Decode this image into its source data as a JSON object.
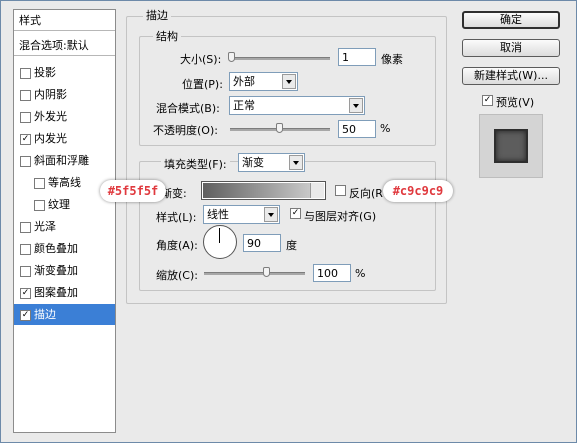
{
  "sidebar": {
    "header": "样式",
    "blend_options": "混合选项:默认",
    "items": [
      {
        "label": "投影",
        "checked": false
      },
      {
        "label": "内阴影",
        "checked": false
      },
      {
        "label": "外发光",
        "checked": false
      },
      {
        "label": "内发光",
        "checked": true
      },
      {
        "label": "斜面和浮雕",
        "checked": false
      },
      {
        "label": "等高线",
        "checked": false
      },
      {
        "label": "纹理",
        "checked": false
      },
      {
        "label": "光泽",
        "checked": false
      },
      {
        "label": "颜色叠加",
        "checked": false
      },
      {
        "label": "渐变叠加",
        "checked": false
      },
      {
        "label": "图案叠加",
        "checked": true
      },
      {
        "label": "描边",
        "checked": true
      }
    ]
  },
  "stroke": {
    "title": "描边",
    "structure": {
      "title": "结构",
      "size_label": "大小(S):",
      "size_value": "1",
      "size_unit": "像素",
      "position_label": "位置(P):",
      "position_value": "外部",
      "blend_label": "混合模式(B):",
      "blend_value": "正常",
      "opacity_label": "不透明度(O):",
      "opacity_value": "50",
      "opacity_unit": "%"
    },
    "fill": {
      "type_label": "填充类型(F):",
      "type_value": "渐变",
      "gradient_label": "渐变:",
      "reverse_label": "反向(R",
      "style_label": "样式(L):",
      "style_value": "线性",
      "align_label": "与图层对齐(G)",
      "angle_label": "角度(A):",
      "angle_value": "90",
      "angle_unit": "度",
      "scale_label": "缩放(C):",
      "scale_value": "100",
      "scale_unit": "%"
    }
  },
  "buttons": {
    "ok": "确定",
    "cancel": "取消",
    "new_style": "新建样式(W)...",
    "preview_label": "预览(V)"
  },
  "annotations": {
    "left_color": "#5f5f5f",
    "right_color": "#c9c9c9"
  },
  "colors": {
    "selection": "#3b7fd6",
    "annotation_text": "#e0393e"
  }
}
